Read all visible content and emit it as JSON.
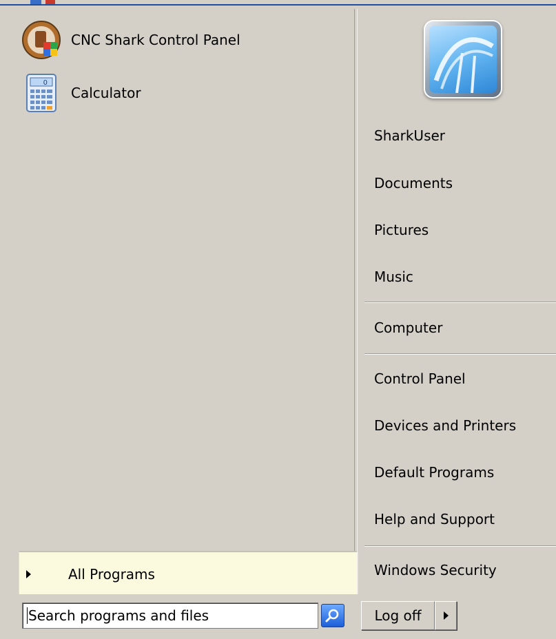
{
  "pinned_programs": [
    {
      "label": "CNC Shark Control Panel",
      "icon": "cnc-shark-icon"
    },
    {
      "label": "Calculator",
      "icon": "calculator-icon"
    }
  ],
  "all_programs": {
    "label": "All Programs"
  },
  "user": {
    "avatar_icon": "user-avatar"
  },
  "right_items": [
    {
      "label": "SharkUser"
    },
    {
      "label": "Documents"
    },
    {
      "label": "Pictures"
    },
    {
      "label": "Music"
    },
    {
      "label": "Computer"
    },
    {
      "label": "Control Panel"
    },
    {
      "label": "Devices and Printers"
    },
    {
      "label": "Default Programs"
    },
    {
      "label": "Help and Support"
    },
    {
      "label": "Windows Security"
    }
  ],
  "search": {
    "placeholder": "Search programs and files",
    "value": "",
    "icon": "search-icon"
  },
  "logoff": {
    "label": "Log off",
    "icon": "chevron-right-icon"
  },
  "colors": {
    "menu_bg": "#d4d0c8",
    "all_programs_bg": "#fbfadf",
    "search_button": "#1b5fd9"
  }
}
